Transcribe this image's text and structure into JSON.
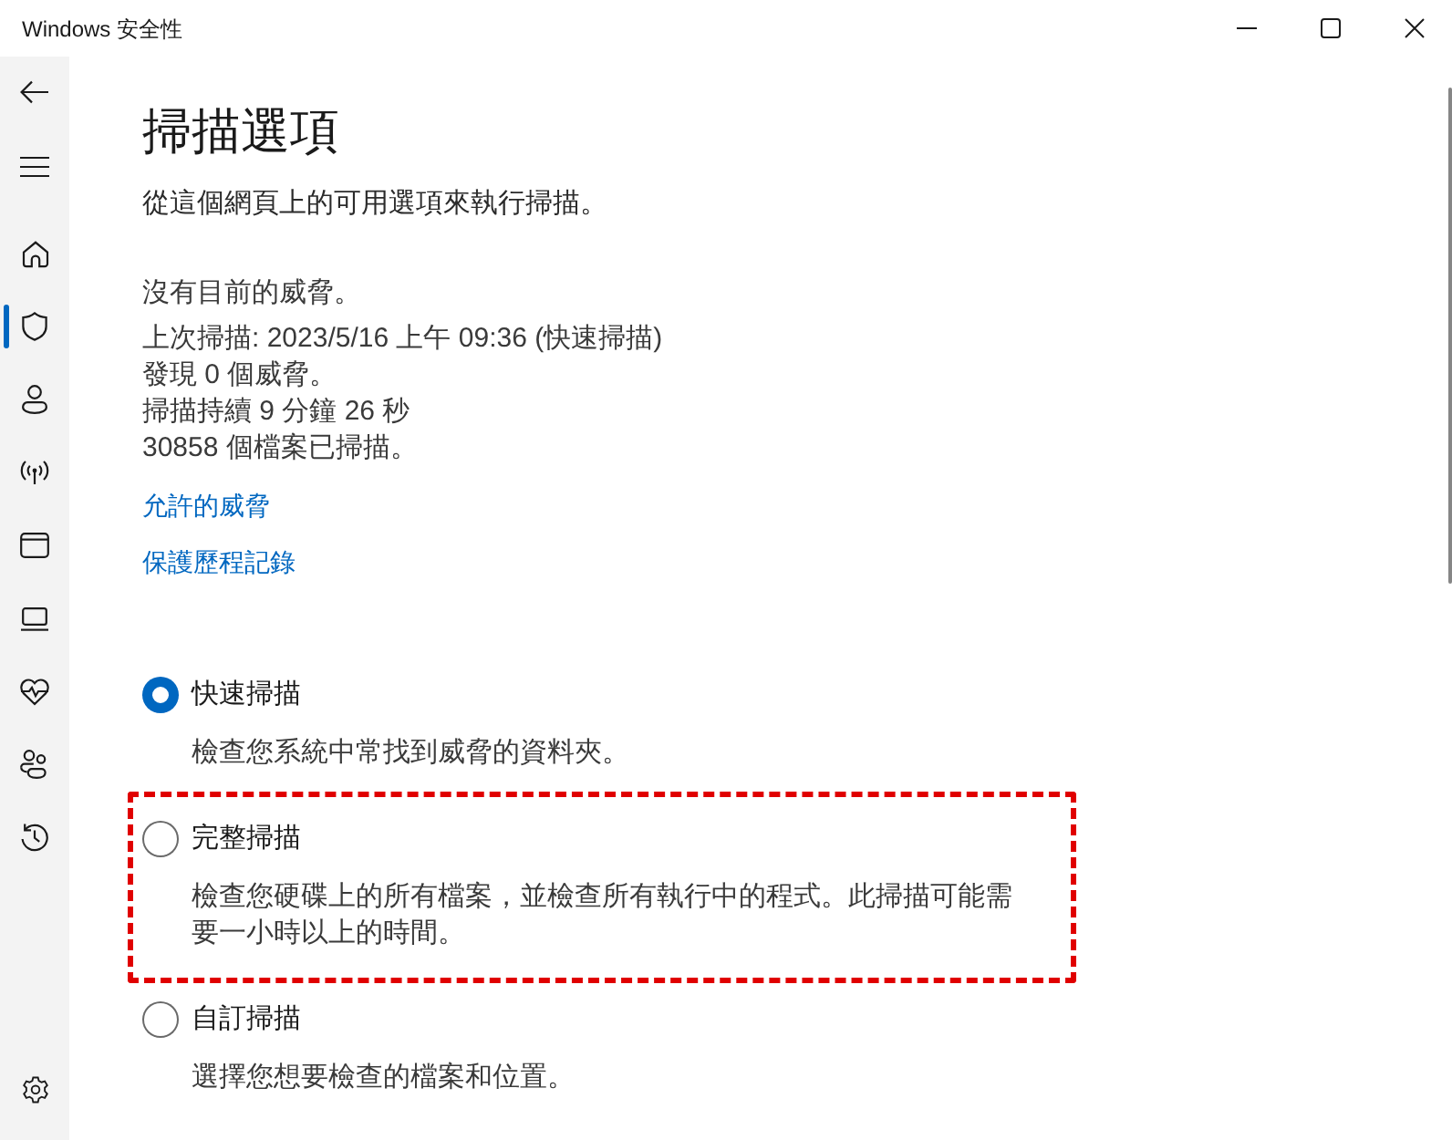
{
  "window": {
    "title": "Windows 安全性"
  },
  "sidebar": {
    "items": [
      {
        "kind": "home",
        "selected": false
      },
      {
        "kind": "shield",
        "selected": true
      },
      {
        "kind": "person",
        "selected": false
      },
      {
        "kind": "antenna",
        "selected": false
      },
      {
        "kind": "window",
        "selected": false
      },
      {
        "kind": "laptop",
        "selected": false
      },
      {
        "kind": "heart",
        "selected": false
      },
      {
        "kind": "family",
        "selected": false
      },
      {
        "kind": "history",
        "selected": false
      }
    ]
  },
  "page": {
    "heading": "掃描選項",
    "subtitle": "從這個網頁上的可用選項來執行掃描。",
    "status": "沒有目前的威脅。",
    "details": [
      "上次掃描: 2023/5/16 上午 09:36 (快速掃描)",
      "發現 0 個威脅。",
      "掃描持續 9 分鐘 26 秒",
      "30858 個檔案已掃描。"
    ],
    "links": [
      "允許的威脅",
      "保護歷程記錄"
    ]
  },
  "scan_options": [
    {
      "label": "快速掃描",
      "description": "檢查您系統中常找到威脅的資料夾。",
      "selected": true,
      "highlighted": false
    },
    {
      "label": "完整掃描",
      "description": "檢查您硬碟上的所有檔案，並檢查所有執行中的程式。此掃描可能需要一小時以上的時間。",
      "selected": false,
      "highlighted": true
    },
    {
      "label": "自訂掃描",
      "description": "選擇您想要檢查的檔案和位置。",
      "selected": false,
      "highlighted": false
    }
  ]
}
